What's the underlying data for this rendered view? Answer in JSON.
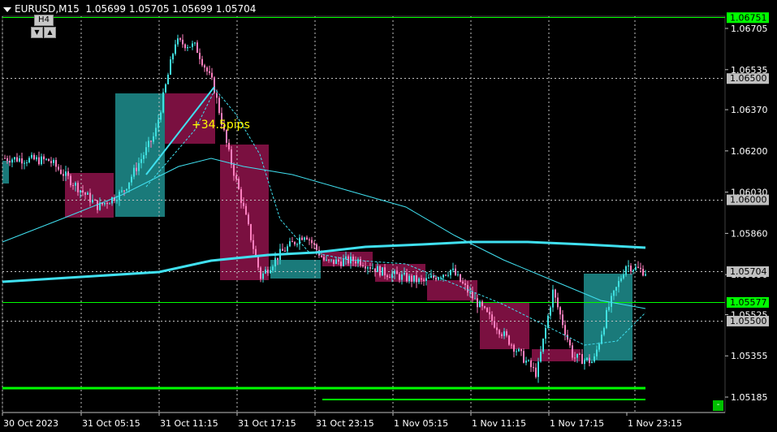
{
  "header": {
    "symbol": "EURUSD,M15",
    "ohlc": "1.05699 1.05705 1.05699 1.05704"
  },
  "timeframe": {
    "label": "H4",
    "down_glyph": "▼",
    "up_glyph": "▲"
  },
  "annotation": {
    "text": "+34.5pips"
  },
  "minus_button": {
    "label": "-"
  },
  "price_axis": {
    "ticks": [
      "1.06705",
      "1.06535",
      "1.06370",
      "1.06200",
      "1.06030",
      "1.05860",
      "1.05690",
      "1.05525",
      "1.05355",
      "1.05185"
    ],
    "tick_values": [
      1.06705,
      1.06535,
      1.0637,
      1.062,
      1.0603,
      1.0586,
      1.0569,
      1.05525,
      1.05355,
      1.05185
    ]
  },
  "time_axis": {
    "labels": [
      "30 Oct 2023",
      "31 Oct 05:15",
      "31 Oct 11:15",
      "31 Oct 17:15",
      "31 Oct 23:15",
      "1 Nov 05:15",
      "1 Nov 11:15",
      "1 Nov 17:15",
      "1 Nov 23:15"
    ]
  },
  "price_levels": [
    {
      "price": 1.06751,
      "label": "1.06751",
      "color": "#00ff00"
    },
    {
      "price": 1.065,
      "label": "1.06500",
      "color": "#c0c0c0"
    },
    {
      "price": 1.06,
      "label": "1.06000",
      "color": "#c0c0c0"
    },
    {
      "price": 1.05704,
      "label": "1.05704",
      "color": "#c0c0c0"
    },
    {
      "price": 1.05577,
      "label": "1.05577",
      "color": "#00ff00"
    },
    {
      "price": 1.055,
      "label": "1.05500",
      "color": "#c0c0c0"
    }
  ],
  "colors": {
    "background": "#000000",
    "bull_candle": "#40e0e0",
    "bear_candle": "#ff80c0",
    "bull_box": "#1a7a7a",
    "bear_box": "#7a1040",
    "ma_line": "#40e0f0",
    "level_green": "#00ff00",
    "grid": "#c0c0c0",
    "text": "#ffffff",
    "annotation": "#ffff00"
  }
}
